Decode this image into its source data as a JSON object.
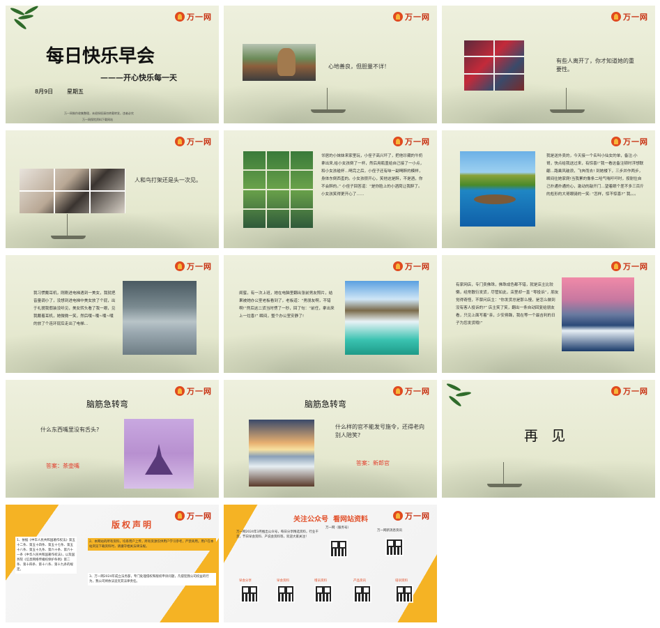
{
  "brand": {
    "name": "万一网",
    "tagline": "最专业的保险学习网站"
  },
  "s1": {
    "title": "每日快乐早会",
    "subtitle": "———开心快乐每一天",
    "date": "8月9日",
    "weekday": "星期五",
    "footer1": "万一网制作收集整理，未经授权请勿转载转发，违者必究",
    "footer2": "万一网保险资料下载网站"
  },
  "s2": {
    "caption": "心地善良，但胆量不详！"
  },
  "s3": {
    "caption": "有些人离开了，你才知道她的重要性。"
  },
  "s4": {
    "caption": "人和鸟打架还是头一次见。"
  },
  "s5": {
    "text": "邻居的小妹妹来家里玩，小侄子高兴坏了，把他珍藏的牛奶拿出来,给小女孩倒了一杯，然后用瓶盖给自己接了一小点，和小女孩碰杯…喝完之后，小侄子还有味一副喝醉的模样，身体东倒西歪的。小女孩很开心，笑他这是醉，不是酒，你不会醉的。” 小侄子回答道：“是你脸上的小酒窝让我醉了。小女孩笑得更开心了……"
  },
  "s6": {
    "text": "我是送外卖的，今天接一个名叫小仙女的单，备注:小哥，快点给我送过来，有惊喜!”我一看这备注顿时浮想联翩…路乘风破浪，飞奔而去! 到她楼下，三步并作两步，瞬间往她家爬!当我累的像条二哈气喘吁吁时，按耐住自己扑通扑通的心，激动的敲开门…望着眼个差不多三百斤的彪形的大哥眼骑的一笑: “怎样，惊不惊喜?” 我。。。"
  },
  "s7": {
    "text": "我习惯戴耳机，刚刚进电梯遇到一美女，我就把音量调小了，没想到进电梯中美女放了个屁，出于礼貌我假装没听见，美女转头看了我一眼，见我戴着耳机，她微微一笑，然后噗~噗~噗~噗的放了个连环屁后走出了电梯…"
  },
  "s8": {
    "text": "闺蜜，有一次上班，她在电脑里翻出张前男友照片，结果被她办公室老板看到了，老板道：“男朋友啊，不错啊!”然后这二货当时愣了一秒，回了句：“前任，拿出来上一炷香!” 瞬间，整个办公室安静了!"
  },
  "s9": {
    "text": "有家网店，专门卖佛珠，佛珠成色都不错，就是店主比较懒，经常敷衍发货，尽管如此，店里却一直 “零投诉”，朋友觉得奇怪，不禁问店主：“你发货总是那么慢，是怎么做到没有客人投诉的?” 店主笑了笑，翻出一条自动回复给朋友看，只见上面写着“亲，少安毋躁，我在等一个最吉利的日子为您发货哦!”"
  },
  "s10": {
    "title": "脑筋急转弯",
    "question": "什么东西嘴里没有舌头?",
    "answer": "答案：茶壶嘴"
  },
  "s11": {
    "title": "脑筋急转弯",
    "question": "什么样的官不能发号施令，还得老向别人陪笑?",
    "answer": "答案：新郎官"
  },
  "s12": {
    "title": "再   见"
  },
  "s13": {
    "title": "版权声明",
    "p1": "1、依据《中华人民共和国著作权法》第五十二条、第五十四条、第五十七条、第五十八条、第五十九条、第六十条、第六十一条《中华人民共和国著作权法》，以及国务院《信息网络传播权保护条例》第二条、第十四条、第十八条、第十九条的规定。",
    "p2": "2、本网站的所有资料，均系用户上传，所有资源仅供用户学习参考，严禁商用。用户在本站浏览下载资料时，请遵守相关法律法规。",
    "p3": "3、万一网2024年成立法务部，专门处理侵权和版权申诉问题，凡侵犯我公司权益的行为，我公司将依法追究其法律责任。"
  },
  "s14": {
    "title": "关注公众号  看网站资料",
    "intro": "万一网2024年3月推出公众号，每日分享精选资料，行业干货，节日早会资料、产说会资料等，欢迎大家关注！",
    "labels": [
      "万一网（服务号）",
      "万一网新消息资讯"
    ],
    "bottom_labels": [
      "早会分享",
      "早会资料",
      "增员资料",
      "产品资讯",
      "培训资料"
    ]
  }
}
